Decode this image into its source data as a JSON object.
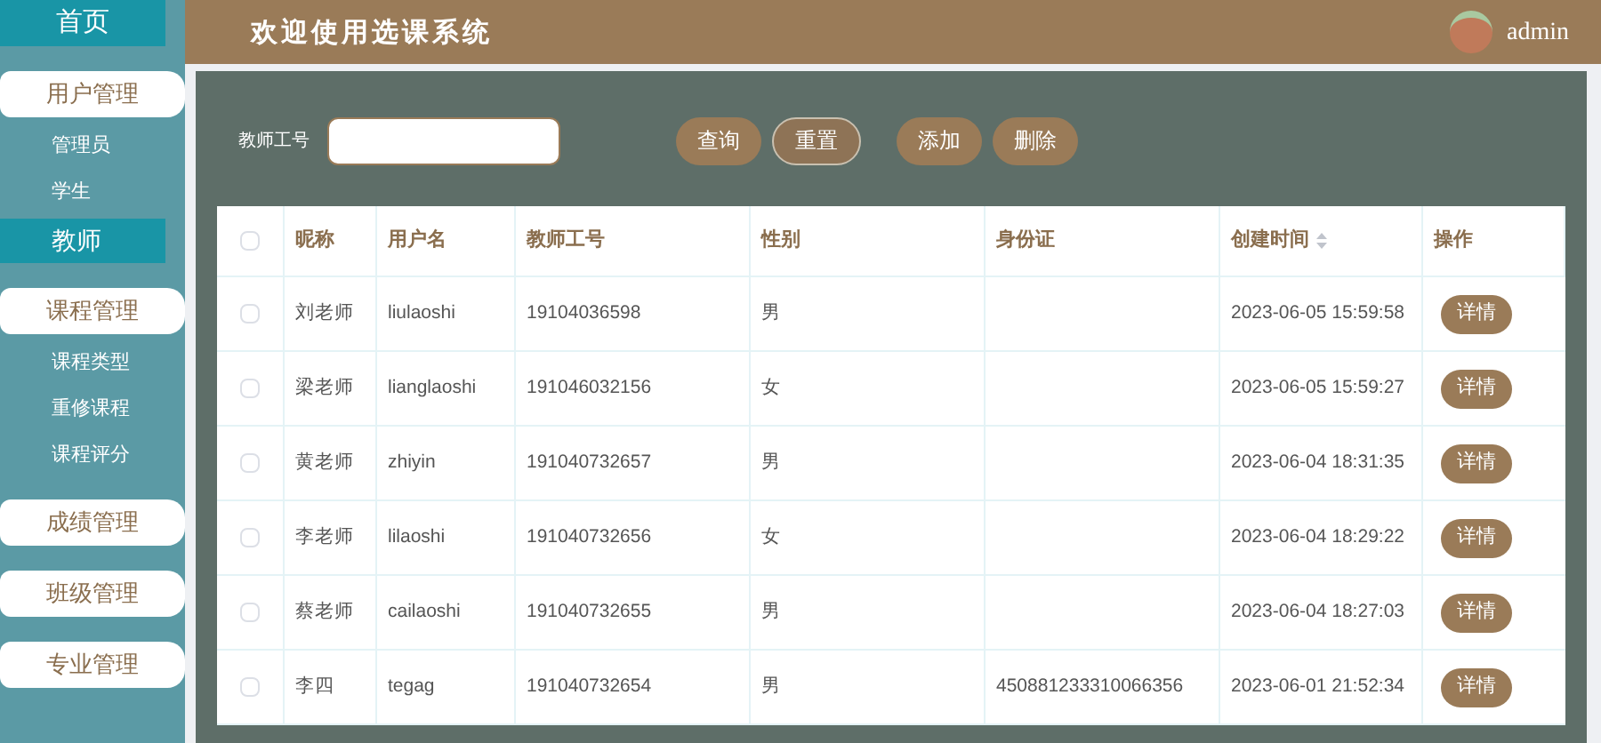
{
  "sidebar": {
    "home": {
      "label": "首页",
      "selected": false
    },
    "groups": [
      {
        "label": "用户管理",
        "items": [
          {
            "label": "管理员",
            "selected": false
          },
          {
            "label": "学生",
            "selected": false
          },
          {
            "label": "教师",
            "selected": true
          }
        ]
      },
      {
        "label": "课程管理",
        "items": [
          {
            "label": "课程类型",
            "selected": false
          },
          {
            "label": "重修课程",
            "selected": false
          },
          {
            "label": "课程评分",
            "selected": false
          }
        ]
      },
      {
        "label": "成绩管理"
      },
      {
        "label": "班级管理"
      },
      {
        "label": "专业管理"
      }
    ]
  },
  "header": {
    "title": "欢迎使用选课系统",
    "user": "admin"
  },
  "search": {
    "label": "教师工号"
  },
  "buttons": [
    "查询",
    "重置",
    "添加",
    "删除"
  ],
  "table": {
    "select_all_checked": false,
    "columns": [
      "昵称",
      "用户名",
      "教师工号",
      "性别",
      "身份证",
      "创建时间",
      "操作"
    ],
    "rows": [
      {
        "checked": false,
        "cells": [
          "刘老师",
          "liulaoshi",
          "19104036598",
          "男",
          null,
          "2023-06-05 15:59:58"
        ],
        "action": "详情"
      },
      {
        "checked": false,
        "cells": [
          "梁老师",
          "lianglaoshi",
          "191046032156",
          "女",
          null,
          "2023-06-05 15:59:27"
        ],
        "action": "详情"
      },
      {
        "checked": false,
        "cells": [
          "黄老师",
          "zhiyin",
          "191040732657",
          "男",
          null,
          "2023-06-04 18:31:35"
        ],
        "action": "详情"
      },
      {
        "checked": false,
        "cells": [
          "李老师",
          "lilaoshi",
          "191040732656",
          "女",
          null,
          "2023-06-04 18:29:22"
        ],
        "action": "详情"
      },
      {
        "checked": false,
        "cells": [
          "蔡老师",
          "cailaoshi",
          "191040732655",
          "男",
          null,
          "2023-06-04 18:27:03"
        ],
        "action": "详情"
      },
      {
        "checked": false,
        "cells": [
          "李四",
          "tegag",
          "191040732654",
          "男",
          "450881233310066356",
          "2023-06-01 21:52:34"
        ],
        "action": "详情"
      }
    ]
  }
}
